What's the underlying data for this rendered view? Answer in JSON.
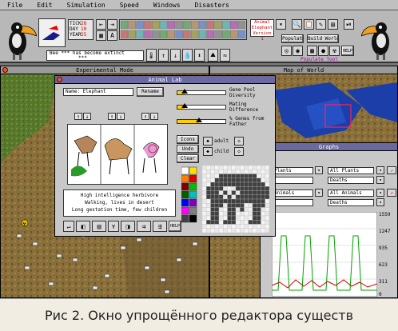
{
  "menu": [
    "File",
    "Edit",
    "Simulation",
    "Speed",
    "Windows",
    "Disasters"
  ],
  "toolbar": {
    "counters": [
      {
        "label": "TICK",
        "value": "28"
      },
      {
        "label": "DAY",
        "value": "10"
      },
      {
        "label": "YEAR",
        "value": "55"
      }
    ],
    "message": "Bee *** has become extinct",
    "message2": "***",
    "selected_tool": {
      "line1": "Animal",
      "line2": "Elephant",
      "line3": "Version 1"
    },
    "populate_label": "Populate",
    "build_world_label": "Build World",
    "populate_tool_label": "Populate Tool",
    "help_label": "HELP"
  },
  "windows": {
    "experimental": {
      "title": "Experimental Mode"
    },
    "map": {
      "title": "Map of World"
    },
    "animal_lab": {
      "title": "Animal Lab",
      "name_field": "Name: Elephant",
      "rename_label": "Rename",
      "sliders": [
        {
          "label": "Gene Pool Diversity",
          "value": 0.15
        },
        {
          "label": "Mating Difference",
          "value": 0.15
        },
        {
          "label": "% Genes from Father",
          "value": 0.45
        }
      ],
      "buttons": {
        "icons": "Icons",
        "undo": "Undo",
        "clear": "Clear"
      },
      "icon_modes": {
        "adult": "adult",
        "child": "child"
      },
      "description": [
        "High intelligence herbivore",
        "Walking, lives in desert",
        "Long gestation time, few children"
      ],
      "help_label": "HELP"
    },
    "graphs": {
      "title": "Graphs",
      "selectors": [
        {
          "type": "Plants",
          "metric": "Deaths",
          "right_type": "All Plants",
          "right_metric": "Deaths"
        },
        {
          "type": "Animals",
          "metric": "",
          "right_type": "All Animals",
          "right_metric": "Deaths"
        }
      ],
      "y_axis": [
        "1559",
        "1247",
        "935",
        "623",
        "311",
        "0"
      ]
    }
  },
  "colors": {
    "toolbar_bg": "#b8b8b8",
    "lab_title": "#6a6aa0",
    "slider_fill": "#ffd000",
    "terrain_experimental": "#8a6e3a",
    "map_water": "#1c3ea8"
  },
  "palette": [
    "#ffffff",
    "#ffe000",
    "#ff8000",
    "#e00000",
    "#800000",
    "#00c000",
    "#006000",
    "#00c0c0",
    "#0000ff",
    "#8000c0",
    "#ff00ff",
    "#808080",
    "#404040",
    "#000000"
  ],
  "caption": "Рис 2. Окно упрощённого редактора существ"
}
